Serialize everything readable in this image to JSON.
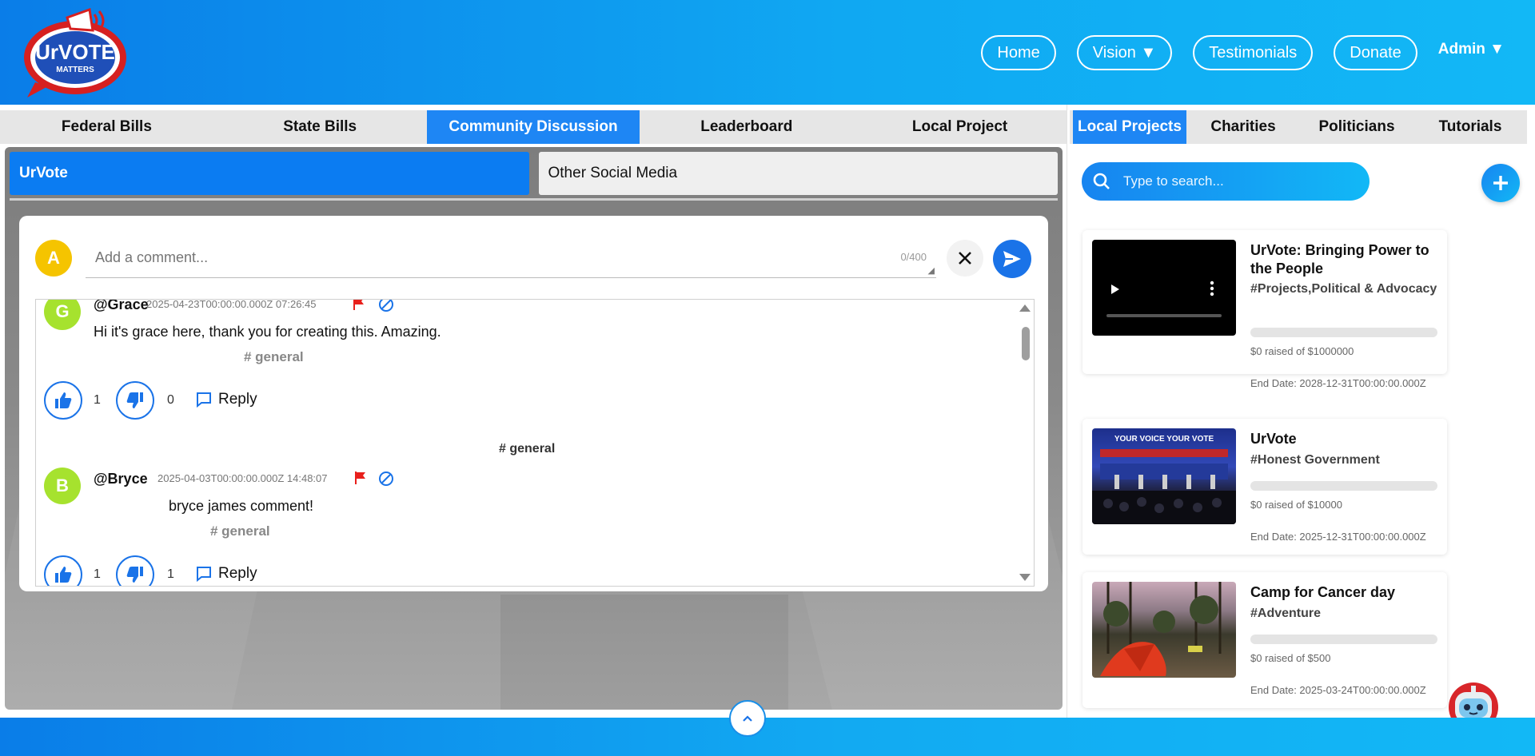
{
  "header": {
    "logo_text": "UrVOTE",
    "logo_subtext": "MATTERS",
    "nav": {
      "home": "Home",
      "vision": "Vision ▼",
      "testimonials": "Testimonials",
      "donate": "Donate",
      "admin": "Admin ▼"
    }
  },
  "main_tabs": [
    "Federal Bills",
    "State Bills",
    "Community Discussion",
    "Leaderboard",
    "Local Project"
  ],
  "sub_tabs": [
    "UrVote",
    "Other Social Media"
  ],
  "composer": {
    "avatar_letter": "A",
    "placeholder": "Add a comment...",
    "counter": "0/400"
  },
  "comments": [
    {
      "avatar": "G",
      "username": "@Grace",
      "timestamp": "2025-04-23T00:00:00.000Z 07:26:45",
      "text": "Hi it's grace here, thank you for creating this. Amazing.",
      "tag": "# general",
      "likes": "1",
      "dislikes": "0",
      "reply": "Reply"
    },
    {
      "group_tag": "# general",
      "avatar": "B",
      "username": "@Bryce",
      "timestamp": "2025-04-03T00:00:00.000Z 14:48:07",
      "text": "bryce james comment!",
      "tag": "# general",
      "likes": "1",
      "dislikes": "1",
      "reply": "Reply"
    }
  ],
  "right_tabs": [
    "Local Projects",
    "Charities",
    "Politicians",
    "Tutorials"
  ],
  "search": {
    "placeholder": "Type to search..."
  },
  "projects": [
    {
      "title": "UrVote: Bringing Power to the People",
      "tags": "#Projects,Political & Advocacy",
      "raised": "$0 raised of $1000000",
      "progress": 0,
      "end_date": "End Date: 2028-12-31T00:00:00.000Z",
      "thumb": "video-player"
    },
    {
      "title": "UrVote",
      "tags": "#Honest Government",
      "raised": "$0 raised of $10000",
      "progress": 0,
      "end_date": "End Date: 2025-12-31T00:00:00.000Z",
      "thumb": "debate-stage"
    },
    {
      "title": "Camp for Cancer day",
      "tags": "#Adventure",
      "raised": "$0 raised of $500",
      "progress": 0,
      "end_date": "End Date: 2025-03-24T00:00:00.000Z",
      "thumb": "camp-tent"
    }
  ],
  "debate_banner": "YOUR VOICE YOUR VOTE",
  "colors": {
    "primary": "#1e86f4",
    "header_start": "#0a7de8",
    "header_end": "#12b8f6",
    "flag": "#e8201c",
    "avatar_composer": "#f5c400",
    "avatar_comment": "#a6e22e"
  }
}
